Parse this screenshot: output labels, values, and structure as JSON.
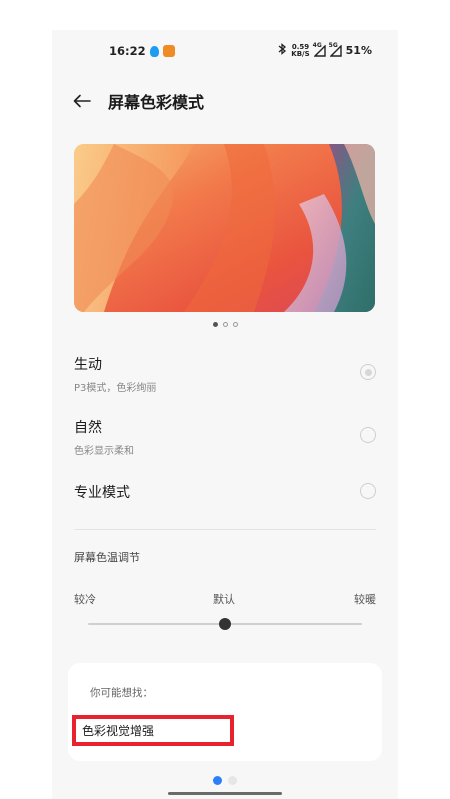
{
  "status_bar": {
    "time": "16:22",
    "speed_value": "0.59",
    "speed_unit": "KB/S",
    "signal1_tag": "4G",
    "signal2_tag": "5G",
    "battery": "51%"
  },
  "header": {
    "title": "屏幕色彩模式"
  },
  "banner": {
    "page_count": 3,
    "active_page": 1
  },
  "options": [
    {
      "label": "生动",
      "sub": "P3模式，色彩绚丽",
      "selected": true
    },
    {
      "label": "自然",
      "sub": "色彩显示柔和",
      "selected": false
    },
    {
      "label": "专业模式",
      "sub": "",
      "selected": false
    }
  ],
  "temperature": {
    "title": "屏幕色温调节",
    "cold": "较冷",
    "default": "默认",
    "warm": "较暖",
    "level": 0.5
  },
  "suggestions": {
    "hint": "你可能想找：",
    "item": "色彩视觉增强"
  },
  "colors": {
    "accent": "#2d7ff9",
    "highlight_box": "#e8232f"
  }
}
